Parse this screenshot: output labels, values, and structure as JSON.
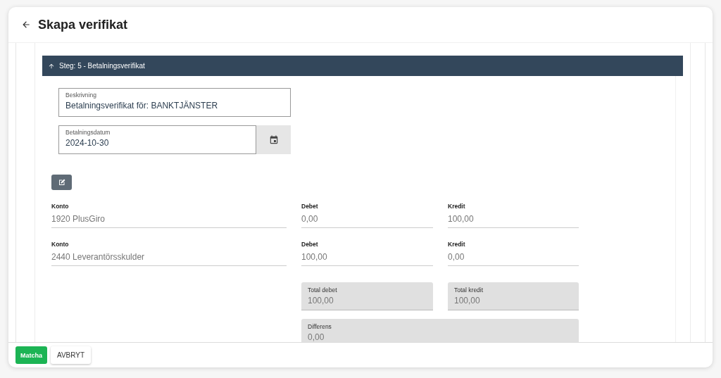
{
  "window": {
    "title": "Skapa verifikat"
  },
  "step_panel": {
    "title": "Steg: 5 - Betalningsverifikat",
    "expanded": true
  },
  "description": {
    "label": "Beskrivning",
    "value": "Betalningsverifikat för: BANKTJÄNSTER"
  },
  "payment_date": {
    "label": "Betalningsdatum",
    "value": "2024-10-30"
  },
  "rows": [
    {
      "account_label": "Konto",
      "account": "1920 PlusGiro",
      "debit_label": "Debet",
      "debit": "0,00",
      "credit_label": "Kredit",
      "credit": "100,00"
    },
    {
      "account_label": "Konto",
      "account": "2440 Leverantörsskulder",
      "debit_label": "Debet",
      "debit": "100,00",
      "credit_label": "Kredit",
      "credit": "0,00"
    }
  ],
  "totals": {
    "debit_label": "Total debet",
    "debit": "100,00",
    "credit_label": "Total kredit",
    "credit": "100,00",
    "difference_label": "Differens",
    "difference": "0,00"
  },
  "buttons": [
    {
      "label": "Matcha",
      "kind": "primary"
    },
    {
      "label": "AVBRYT",
      "kind": "secondary"
    }
  ]
}
